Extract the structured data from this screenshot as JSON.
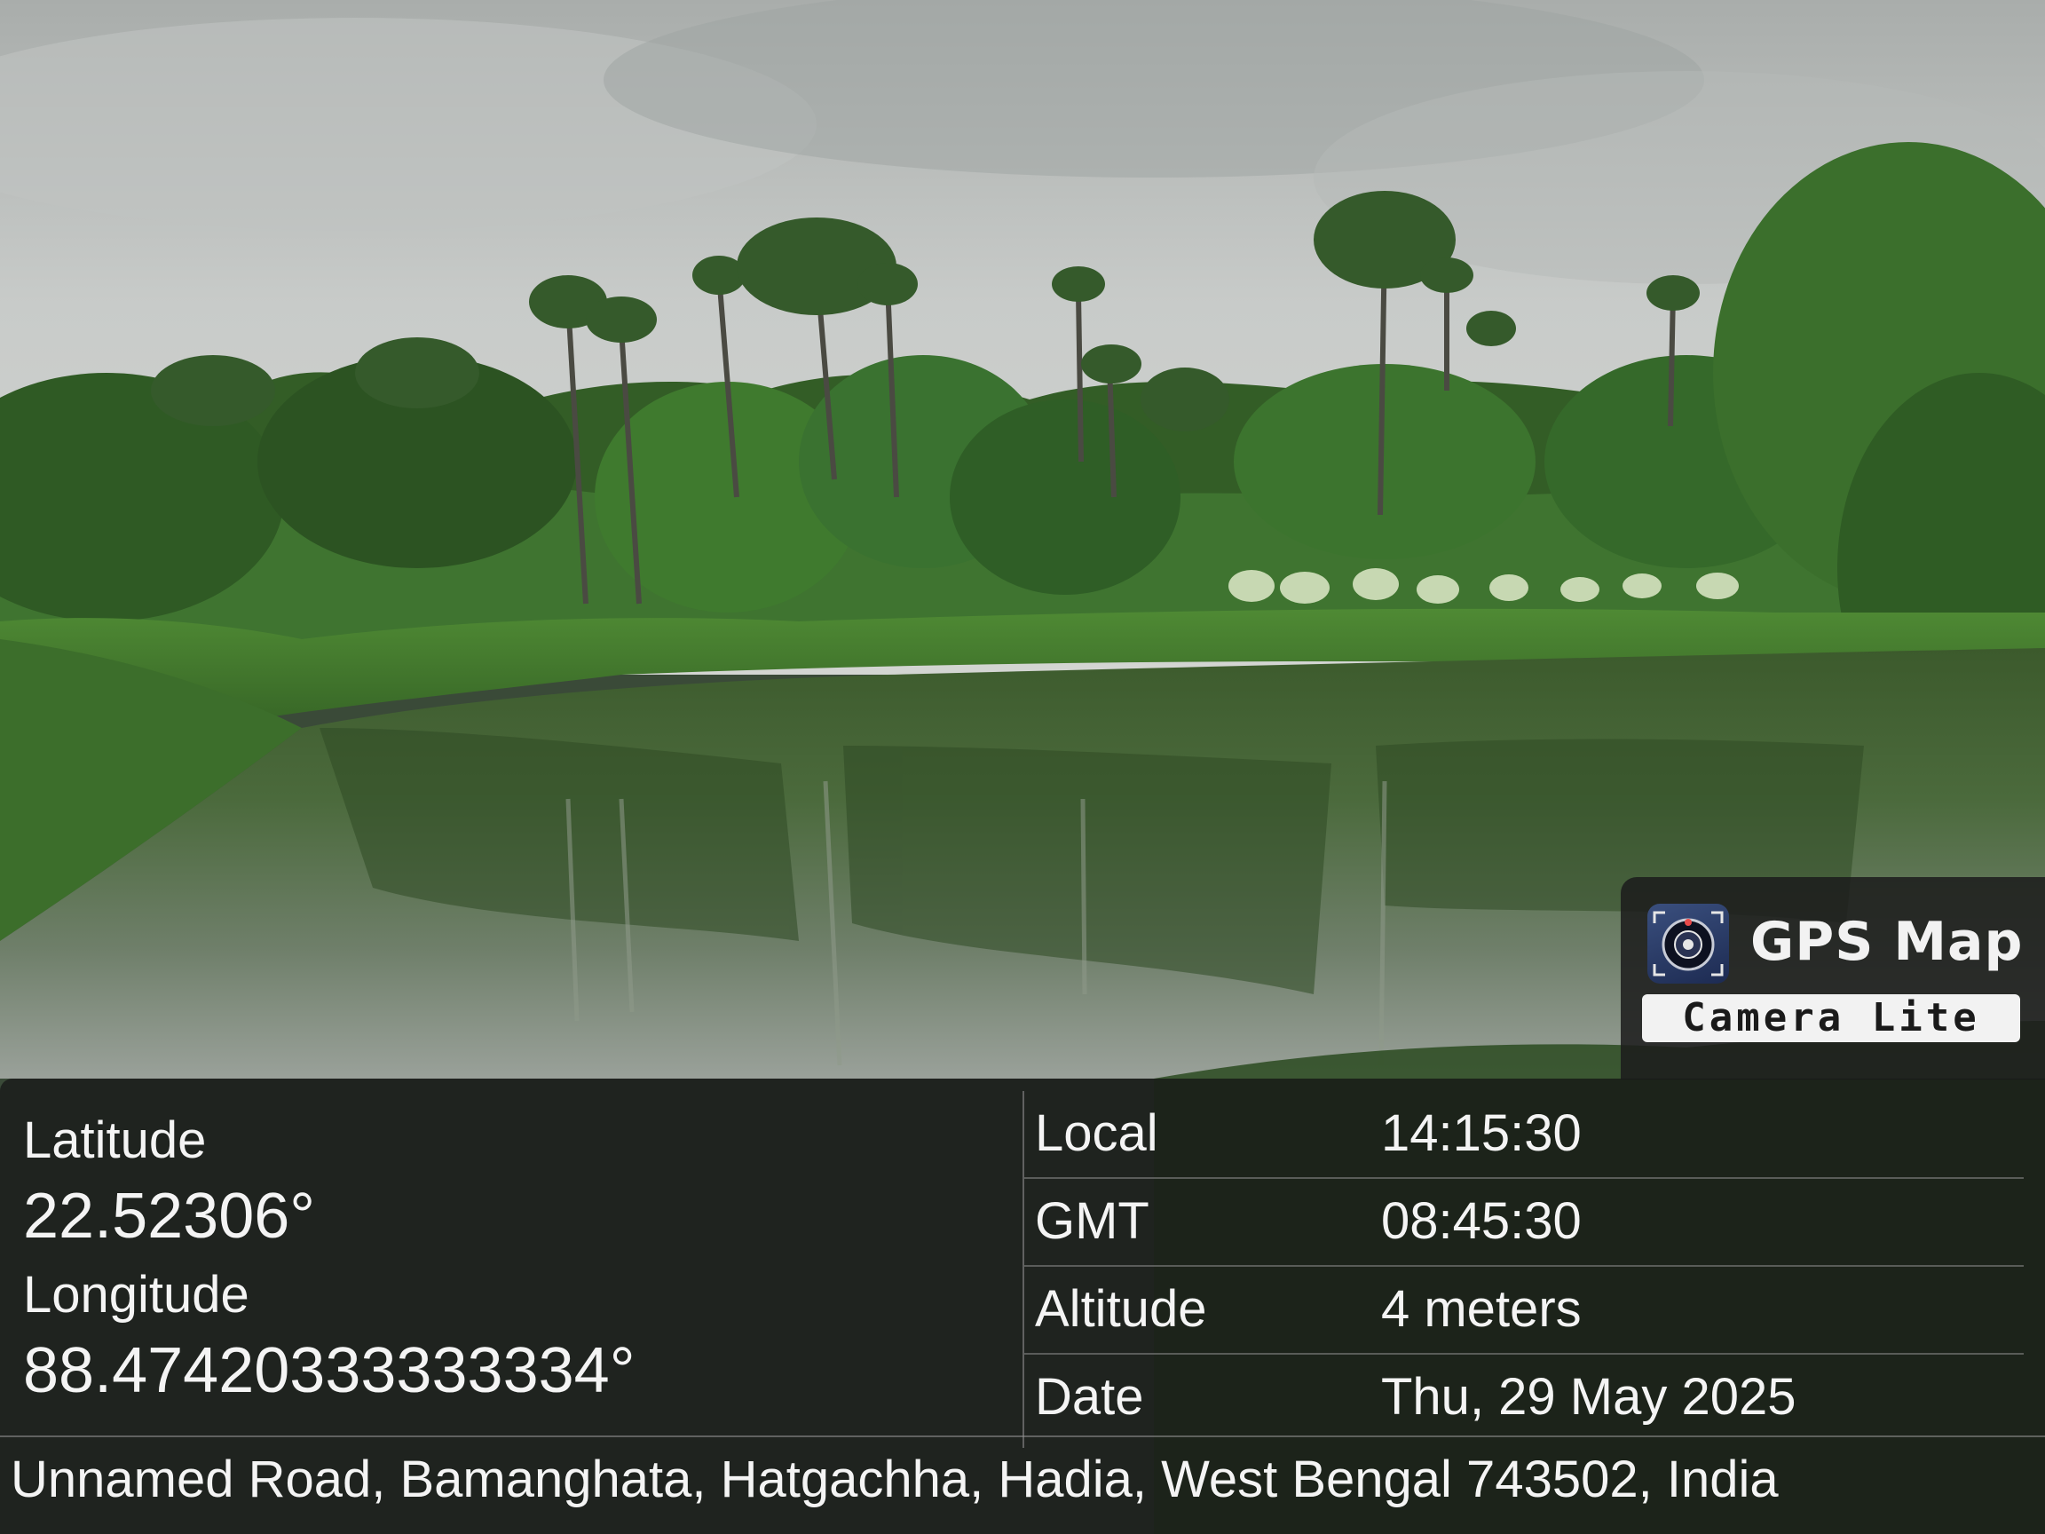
{
  "watermark": {
    "title": "GPS Map",
    "subtitle": "Camera Lite",
    "logo_icon": "camera-compass-icon"
  },
  "location": {
    "latitude_label": "Latitude",
    "latitude_value": "22.52306°",
    "longitude_label": "Longitude",
    "longitude_value": "88.47420333333334°"
  },
  "details": [
    {
      "label": "Local",
      "value": "14:15:30"
    },
    {
      "label": "GMT",
      "value": "08:45:30"
    },
    {
      "label": "Altitude",
      "value": "4 meters"
    },
    {
      "label": "Date",
      "value": "Thu, 29 May 2025"
    }
  ],
  "address": "Unnamed Road, Bamanghata, Hatgachha, Hadia, West Bengal 743502, India",
  "colors": {
    "sky": "#c9cccb",
    "foliage": "#3f6e2e",
    "water": "#4f5f47",
    "panel": "#181818",
    "text": "#f4f4f4"
  }
}
